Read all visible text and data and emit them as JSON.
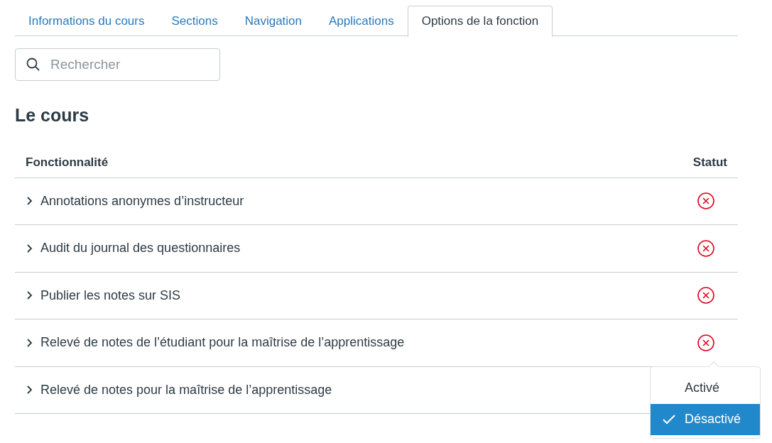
{
  "tabs": [
    {
      "label": "Informations du cours",
      "selected": false
    },
    {
      "label": "Sections",
      "selected": false
    },
    {
      "label": "Navigation",
      "selected": false
    },
    {
      "label": "Applications",
      "selected": false
    },
    {
      "label": "Options de la fonction",
      "selected": true
    }
  ],
  "search": {
    "placeholder": "Rechercher"
  },
  "section_title": "Le cours",
  "table": {
    "columns": [
      "Fonctionnalité",
      "Statut"
    ],
    "rows": [
      {
        "feature": "Annotations anonymes d’instructeur",
        "enabled": false,
        "expanded": false
      },
      {
        "feature": "Audit du journal des questionnaires",
        "enabled": false,
        "expanded": false
      },
      {
        "feature": "Publier les notes sur SIS",
        "enabled": false,
        "expanded": false
      },
      {
        "feature": "Relevé de notes de l’étudiant pour la maîtrise de l’apprentissage",
        "enabled": false,
        "expanded": false
      },
      {
        "feature": "Relevé de notes pour la maîtrise de l’apprentissage",
        "expanded": false
      }
    ]
  },
  "status_menu": {
    "options": [
      {
        "label": "Activé",
        "selected": false
      },
      {
        "label": "Désactivé",
        "selected": true
      }
    ]
  }
}
